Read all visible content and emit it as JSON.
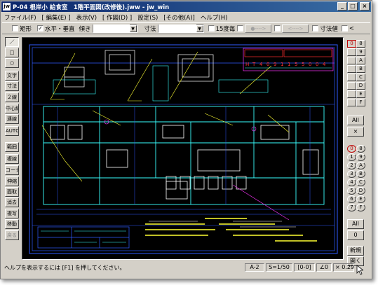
{
  "window": {
    "app_icon_label": "jw",
    "title": "P-04 根岸小 給食室　1階平面図(改修後).jww - jw_win",
    "controls": {
      "minimize": "_",
      "maximize": "□",
      "close": "×"
    }
  },
  "menu": [
    "ファイル(F)",
    "[ 編集(E) ]",
    "表示(V)",
    "[ 作図(D) ]",
    "設定(S)",
    "[その他(A)]",
    "ヘルプ(H)"
  ],
  "toolbar": {
    "rect_label": "矩形",
    "rect_checked": false,
    "hv_label": "水平・垂直",
    "hv_checked": true,
    "slope_label": "傾き",
    "slope_value": "",
    "dim_label": "寸法",
    "dim_value": "",
    "deg15_label": "15度毎",
    "deg15_checked": false,
    "btn1_label": "●---->",
    "btn2_label": "<---->",
    "dimval_label": "寸法値",
    "lt_label": "<",
    "dropdown_arrow": "▼"
  },
  "left_tools": [
    "／",
    "□",
    "○",
    "文字",
    "寸法",
    "２線",
    "中心線",
    "連線",
    "AUTO",
    "範囲",
    "複線",
    "コーナー",
    "伸縮",
    "面取",
    "消去",
    "複写",
    "移動",
    "戻る"
  ],
  "right_layer_groups": {
    "top_left": [
      "0",
      "",
      "",
      "",
      "",
      "",
      "",
      ""
    ],
    "top_right": [
      "8",
      "9",
      "A",
      "B",
      "C",
      "D",
      "E",
      "F"
    ],
    "all_label": "All",
    "x_label": "×",
    "bottom_left": [
      "0",
      "1",
      "2",
      "3",
      "4",
      "5",
      "6",
      "7"
    ],
    "bottom_right": [
      "8",
      "9",
      "A",
      "B",
      "C",
      "D",
      "E",
      "F"
    ],
    "all2_label": "All",
    "zero_label": "0",
    "new_label": "新規",
    "open_label": "開く"
  },
  "drawing": {
    "title_block_text": [
      "H",
      "T",
      "4",
      "0",
      "9",
      "1",
      "1",
      "5",
      "5",
      "0",
      "0",
      "4"
    ]
  },
  "status": {
    "help_text": "ヘルプを表示するには [F1] を押してください。",
    "paper": "A-2",
    "scale": "S=1/50",
    "layer": "[0-0]",
    "angle": "∠0",
    "zoom": "× 0.29"
  },
  "colors": {
    "canvas_bg": "#000000",
    "cad_blue": "#2f5bff",
    "cad_cyan": "#39ffff",
    "cad_yellow": "#ffff33",
    "cad_white": "#ffffff",
    "cad_magenta": "#ff33ff",
    "title_red": "#ff3030",
    "accent_red": "#c00000"
  }
}
